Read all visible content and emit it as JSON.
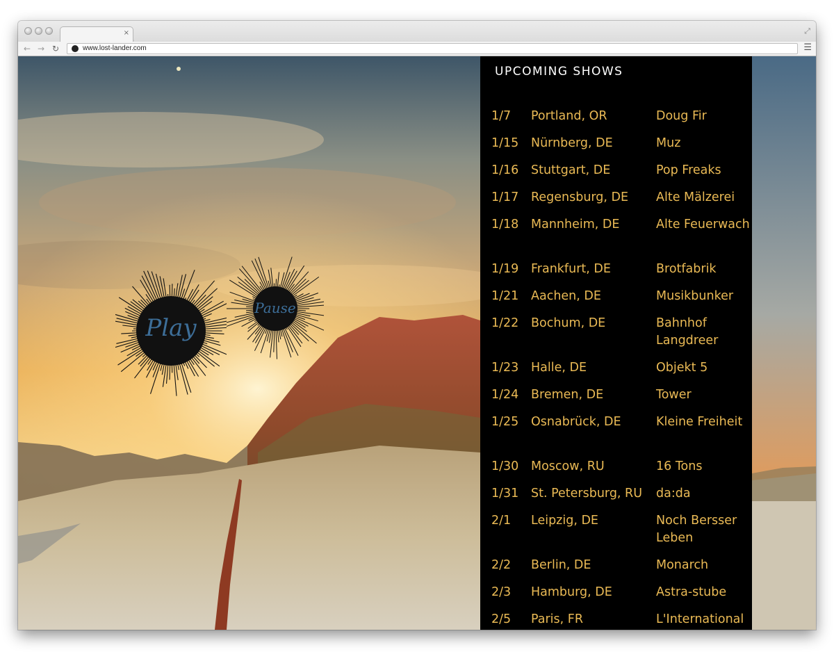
{
  "browser": {
    "url": "www.lost-lander.com",
    "tab_close": "×",
    "menu_icon": "☰"
  },
  "player": {
    "play_label": "Play",
    "pause_label": "Pause"
  },
  "shows": {
    "title": "UPCOMING SHOWS",
    "items": [
      {
        "date": "1/7",
        "city": "Portland, OR",
        "venue": "Doug Fir"
      },
      {
        "date": "1/15",
        "city": "Nürnberg, DE",
        "venue": "Muz"
      },
      {
        "date": "1/16",
        "city": "Stuttgart, DE",
        "venue": "Pop Freaks"
      },
      {
        "date": "1/17",
        "city": "Regensburg, DE",
        "venue": "Alte Mälzerei"
      },
      {
        "date": "1/18",
        "city": "Mannheim, DE",
        "venue": "Alte Feuerwach"
      },
      {
        "date": "1/19",
        "city": "Frankfurt, DE",
        "venue": "Brotfabrik"
      },
      {
        "date": "1/21",
        "city": "Aachen, DE",
        "venue": "Musikbunker"
      },
      {
        "date": "1/22",
        "city": "Bochum, DE",
        "venue": "Bahnhof Langdreer"
      },
      {
        "date": "1/23",
        "city": "Halle, DE",
        "venue": "Objekt 5"
      },
      {
        "date": "1/24",
        "city": "Bremen, DE",
        "venue": "Tower"
      },
      {
        "date": "1/25",
        "city": "Osnabrück, DE",
        "venue": "Kleine Freiheit"
      },
      {
        "date": "1/30",
        "city": "Moscow, RU",
        "venue": "16 Tons"
      },
      {
        "date": "1/31",
        "city": "St. Petersburg, RU",
        "venue": "da:da"
      },
      {
        "date": "2/1",
        "city": "Leipzig, DE",
        "venue": "Noch Bersser Leben"
      },
      {
        "date": "2/2",
        "city": "Berlin, DE",
        "venue": "Monarch"
      },
      {
        "date": "2/3",
        "city": "Hamburg, DE",
        "venue": "Astra-stube"
      },
      {
        "date": "2/5",
        "city": "Paris, FR",
        "venue": "L'International"
      }
    ]
  },
  "colors": {
    "panel_bg": "#000000",
    "show_text": "#eaba55",
    "title_text": "#ffffff",
    "player_label": "#3d6e98"
  }
}
